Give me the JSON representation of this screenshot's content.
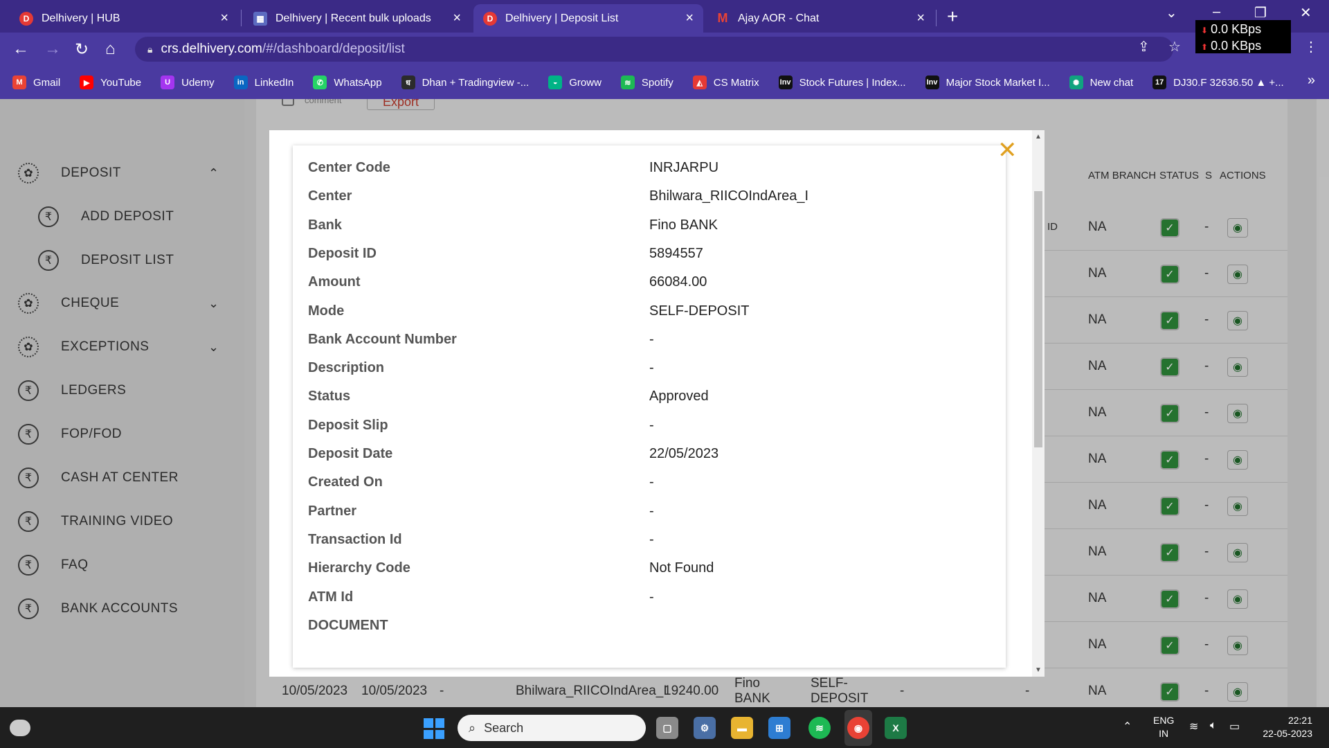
{
  "browser": {
    "tabs": [
      {
        "title": "Delhivery | HUB",
        "icon": "delhivery-icon",
        "color": "#e53935"
      },
      {
        "title": "Delhivery | Recent bulk uploads",
        "icon": "grid-icon",
        "color": "#5c6bc0"
      },
      {
        "title": "Delhivery | Deposit List",
        "icon": "delhivery-icon",
        "color": "#e53935"
      },
      {
        "title": "Ajay AOR - Chat",
        "icon": "gmail-icon",
        "color": "#ea4335"
      }
    ],
    "url_host": "crs.delhivery.com",
    "url_path": "/#/dashboard/deposit/list",
    "net_speed_down": "0.0 KBps",
    "net_speed_up": "0.0 KBps",
    "bookmarks": [
      {
        "label": "Gmail",
        "glyph": "M",
        "color": "#ea4335"
      },
      {
        "label": "YouTube",
        "glyph": "▶",
        "color": "#ff0000"
      },
      {
        "label": "Udemy",
        "glyph": "U",
        "color": "#a435f0"
      },
      {
        "label": "LinkedIn",
        "glyph": "in",
        "color": "#0a66c2"
      },
      {
        "label": "WhatsApp",
        "glyph": "✆",
        "color": "#25d366"
      },
      {
        "label": "Dhan + Tradingview -...",
        "glyph": "ध",
        "color": "#2b2b2b"
      },
      {
        "label": "Groww",
        "glyph": "◒",
        "color": "#00b386"
      },
      {
        "label": "Spotify",
        "glyph": "≋",
        "color": "#1db954"
      },
      {
        "label": "CS Matrix",
        "glyph": "◭",
        "color": "#e53935"
      },
      {
        "label": "Stock Futures | Index...",
        "glyph": "Inv",
        "color": "#111111"
      },
      {
        "label": "Major Stock Market I...",
        "glyph": "Inv",
        "color": "#111111"
      },
      {
        "label": "New chat",
        "glyph": "✺",
        "color": "#10a37f"
      },
      {
        "label": "DJ30.F 32636.50 ▲ +...",
        "glyph": "17",
        "color": "#111111"
      }
    ]
  },
  "sidebar": {
    "items": [
      {
        "label": "DEPOSIT",
        "icon": "gear-icon",
        "chevron": "⌃"
      },
      {
        "label": "ADD DEPOSIT",
        "icon": "rupee-icon",
        "chevron": ""
      },
      {
        "label": "DEPOSIT LIST",
        "icon": "rupee-icon",
        "chevron": ""
      },
      {
        "label": "CHEQUE",
        "icon": "gear-icon",
        "chevron": "⌄"
      },
      {
        "label": "EXCEPTIONS",
        "icon": "gear-icon",
        "chevron": "⌄"
      },
      {
        "label": "LEDGERS",
        "icon": "rupee-icon",
        "chevron": ""
      },
      {
        "label": "FOP/FOD",
        "icon": "rupee-icon",
        "chevron": ""
      },
      {
        "label": "CASH AT CENTER",
        "icon": "rupee-icon",
        "chevron": ""
      },
      {
        "label": "TRAINING VIDEO",
        "icon": "rupee-icon",
        "chevron": ""
      },
      {
        "label": "FAQ",
        "icon": "rupee-icon",
        "chevron": ""
      },
      {
        "label": "BANK ACCOUNTS",
        "icon": "rupee-icon",
        "chevron": ""
      }
    ]
  },
  "toolbar": {
    "comment_label": "comment",
    "export_label": "Export"
  },
  "table": {
    "headers": [
      "ID",
      "ATM BRANCH",
      "STATUS",
      "S",
      "ACTIONS"
    ],
    "rows": [
      {
        "atm_branch": "NA",
        "s": "-"
      },
      {
        "atm_branch": "NA",
        "s": "-"
      },
      {
        "atm_branch": "NA",
        "s": "-"
      },
      {
        "atm_branch": "NA",
        "s": "-"
      },
      {
        "atm_branch": "NA",
        "s": "-"
      },
      {
        "atm_branch": "NA",
        "s": "-"
      },
      {
        "atm_branch": "NA",
        "s": "-"
      },
      {
        "atm_branch": "NA",
        "s": "-"
      },
      {
        "atm_branch": "NA",
        "s": "-"
      },
      {
        "atm_branch": "NA",
        "s": "-"
      },
      {
        "atm_branch": "NA",
        "s": "-"
      }
    ],
    "bottom_row": {
      "deposit_date": "10/05/2023",
      "created_on": "10/05/2023",
      "dash1": "-",
      "center": "Bhilwara_RIICOIndArea_I",
      "amount": "19240.00",
      "bank": "Fino BANK",
      "mode": "SELF-DEPOSIT",
      "dash2": "-",
      "dash3": "-"
    }
  },
  "modal": {
    "details": [
      {
        "label": "Center Code",
        "value": "INRJARPU"
      },
      {
        "label": "Center",
        "value": "Bhilwara_RIICOIndArea_I"
      },
      {
        "label": "Bank",
        "value": "Fino BANK"
      },
      {
        "label": "Deposit ID",
        "value": "5894557"
      },
      {
        "label": "Amount",
        "value": "66084.00"
      },
      {
        "label": "Mode",
        "value": "SELF-DEPOSIT"
      },
      {
        "label": "Bank Account Number",
        "value": "-"
      },
      {
        "label": "Description",
        "value": "-"
      },
      {
        "label": "Status",
        "value": "Approved"
      },
      {
        "label": "Deposit Slip",
        "value": "-"
      },
      {
        "label": "Deposit Date",
        "value": "22/05/2023"
      },
      {
        "label": "Created On",
        "value": "-"
      },
      {
        "label": "Partner",
        "value": "-"
      },
      {
        "label": "Transaction Id",
        "value": "-"
      },
      {
        "label": "Hierarchy Code",
        "value": "Not Found"
      },
      {
        "label": "ATM Id",
        "value": "-"
      },
      {
        "label": "DOCUMENT",
        "value": ""
      }
    ]
  },
  "taskbar": {
    "search_placeholder": "Search",
    "lang_line1": "ENG",
    "lang_line2": "IN",
    "time": "22:21",
    "date": "22-05-2023"
  },
  "colors": {
    "chrome_dark": "#3b2a86",
    "chrome": "#4a3aa0",
    "close_accent": "#e0a020",
    "status_green": "#2e8b3a"
  }
}
